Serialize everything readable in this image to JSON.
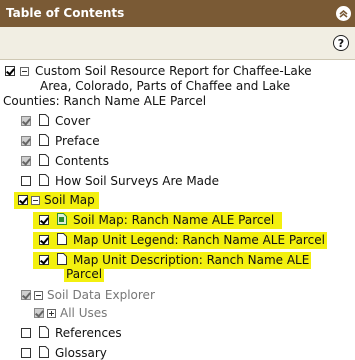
{
  "header": {
    "title": "Table of Contents"
  },
  "toolbar": {
    "help_label": "?"
  },
  "report": {
    "title_line1": "Custom Soil Resource Report for Chaffee-Lake",
    "title_line2": "Area, Colorado, Parts of Chaffee and Lake",
    "title_line3": "Counties: Ranch Name ALE Parcel"
  },
  "items": {
    "cover": "Cover",
    "preface": "Preface",
    "contents": "Contents",
    "how_soil_surveys": "How Soil Surveys Are Made",
    "soil_map": "Soil Map",
    "soil_map_ranch": "Soil Map: Ranch Name ALE Parcel",
    "map_unit_legend": "Map Unit Legend: Ranch Name ALE Parcel",
    "map_unit_desc_1": "Map Unit Description: Ranch Name ALE",
    "map_unit_desc_2": "Parcel",
    "soil_data_explorer": "Soil Data Explorer",
    "all_uses": "All Uses",
    "references": "References",
    "glossary": "Glossary"
  },
  "colors": {
    "header": "#7a5a35",
    "toolbar": "#f1eee3",
    "highlight": "#f3f00f",
    "accent_green": "#2e8b2e"
  }
}
